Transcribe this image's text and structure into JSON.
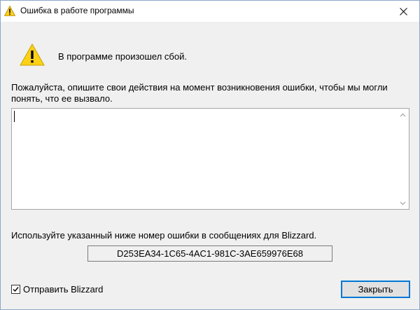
{
  "window": {
    "title": "Ошибка в работе программы"
  },
  "dialog": {
    "message": "В программе произошел сбой.",
    "prompt": "Пожалуйста, опишите свои действия на момент возникновения ошибки, чтобы мы могли понять, что ее вызвало.",
    "description_value": "",
    "hint": "Используйте указанный ниже номер ошибки в сообщениях для Blizzard.",
    "error_code": "D253EA34-1C65-4AC1-981C-3AE659976E68",
    "send_checkbox": {
      "label": "Отправить Blizzard",
      "checked": true
    },
    "close_button": "Закрыть"
  },
  "icons": {
    "title": "warning-icon",
    "main": "warning-icon",
    "close": "close-icon",
    "scroll_up": "chevron-up-icon",
    "scroll_down": "chevron-down-icon",
    "check": "checkmark-icon"
  },
  "colors": {
    "warning_fill": "#fcd116",
    "focus_border": "#0078d7",
    "background": "#f0f0f0"
  }
}
